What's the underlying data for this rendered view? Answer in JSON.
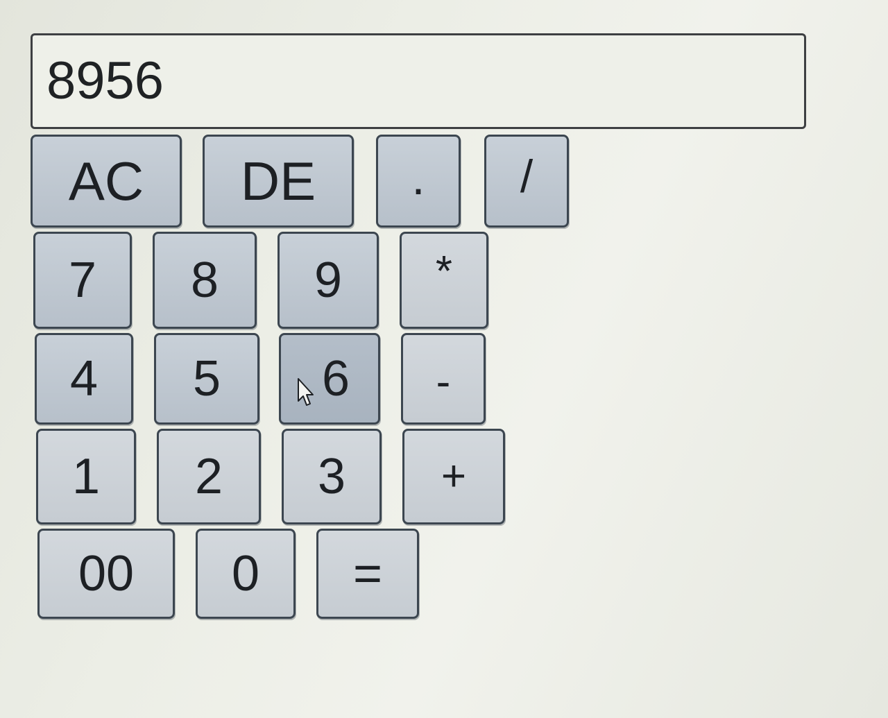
{
  "display": {
    "value": "8956"
  },
  "keys": {
    "ac": "AC",
    "de": "DE",
    "dot": ".",
    "divide": "/",
    "seven": "7",
    "eight": "8",
    "nine": "9",
    "multiply": "*",
    "four": "4",
    "five": "5",
    "six": "6",
    "minus": "-",
    "one": "1",
    "two": "2",
    "three": "3",
    "plus": "+",
    "double_zero": "00",
    "zero": "0",
    "equals": "="
  },
  "colors": {
    "key_fill": "#c8d0d8",
    "key_border": "#3c4650",
    "display_border": "#3d3f42",
    "background": "#eceee6"
  },
  "cursor": {
    "icon": "mouse-pointer-icon"
  }
}
